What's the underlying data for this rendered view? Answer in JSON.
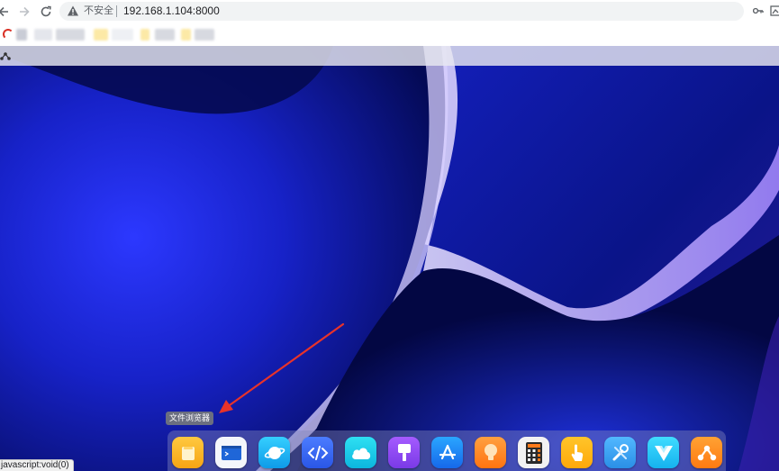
{
  "browser": {
    "address": {
      "security_label": "不安全",
      "url": "192.168.1.104:8000",
      "security_icon": "warning-icon"
    },
    "nav_icons": [
      "back-icon",
      "forward-icon",
      "reload-icon"
    ],
    "toolbar_icons": [
      "key-icon",
      "extension-icon"
    ],
    "status_text": "javascript:void(0)"
  },
  "desktop": {
    "topbar_icon": "app-menu-icon",
    "dock_tooltip": "文件浏览器",
    "dock_apps": [
      {
        "name": "file-browser",
        "icon": "folder-icon",
        "color": "#fbb322"
      },
      {
        "name": "terminal",
        "icon": "terminal-icon",
        "color": "#1f66d8"
      },
      {
        "name": "browser",
        "icon": "planet-icon",
        "color": "#18b6f6"
      },
      {
        "name": "code-editor",
        "icon": "code-icon",
        "color": "#3a6cf2"
      },
      {
        "name": "cloud",
        "icon": "cloud-icon",
        "color": "#13c6e6"
      },
      {
        "name": "markdown",
        "icon": "brush-icon",
        "color": "#8a45ef"
      },
      {
        "name": "app-store",
        "icon": "app-store-icon",
        "color": "#1e88f5"
      },
      {
        "name": "ideas",
        "icon": "bulb-icon",
        "color": "#ff8a1f"
      },
      {
        "name": "calculator",
        "icon": "calculator-icon",
        "color": "#f5f5f5"
      },
      {
        "name": "touch",
        "icon": "hand-icon",
        "color": "#ffb80f"
      },
      {
        "name": "tools",
        "icon": "wrench-icon",
        "color": "#3aa8f0"
      },
      {
        "name": "vue",
        "icon": "vue-icon",
        "color": "#25c6f5"
      },
      {
        "name": "network",
        "icon": "nodes-icon",
        "color": "#ff8a1a"
      }
    ]
  },
  "colors": {
    "wallpaper_dark": "#050a4a",
    "wallpaper_mid": "#1a2ae0",
    "annotation_arrow": "#e8332a"
  }
}
